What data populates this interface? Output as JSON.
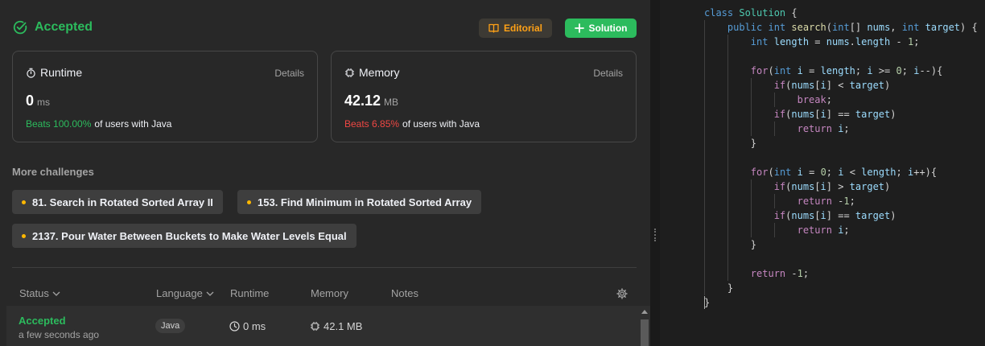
{
  "submission": {
    "status": "Accepted",
    "editorial_label": "Editorial",
    "solution_label": "Solution"
  },
  "runtime_card": {
    "title": "Runtime",
    "details": "Details",
    "value": "0",
    "unit": "ms",
    "beats": "Beats 100.00%",
    "suffix": "of users with Java"
  },
  "memory_card": {
    "title": "Memory",
    "details": "Details",
    "value": "42.12",
    "unit": "MB",
    "beats": "Beats 6.85%",
    "suffix": "of users with Java"
  },
  "more_challenges": {
    "title": "More challenges",
    "items": [
      "81. Search in Rotated Sorted Array II",
      "153. Find Minimum in Rotated Sorted Array",
      "2137. Pour Water Between Buckets to Make Water Levels Equal"
    ]
  },
  "history": {
    "columns": [
      "Status",
      "Language",
      "Runtime",
      "Memory",
      "Notes"
    ],
    "rows": [
      {
        "status": "Accepted",
        "time": "a few seconds ago",
        "language": "Java",
        "runtime": "0 ms",
        "memory": "42.1 MB"
      }
    ]
  },
  "editor": {
    "lines": [
      "class Solution {",
      "    public int search(int[] nums, int target) {",
      "        int length = nums.length - 1;",
      "",
      "        for(int i = length; i >= 0; i--){",
      "            if(nums[i] < target)",
      "                break;",
      "            if(nums[i] == target)",
      "                return i;",
      "        }",
      "",
      "        for(int i = 0; i < length; i++){",
      "            if(nums[i] > target)",
      "                return -1;",
      "            if(nums[i] == target)",
      "                return i;",
      "        }",
      "",
      "        return -1;",
      "    }",
      "}"
    ],
    "current_line": 21
  },
  "colors": {
    "accepted": "#2cbb5d",
    "editorial": "#ffa116",
    "beats_good": "#2cbb5d",
    "beats_bad": "#ef4743"
  },
  "icons": {
    "status": "check-circle-icon",
    "editorial": "book-icon",
    "solution": "plus-icon",
    "runtime": "stopwatch-icon",
    "memory": "chip-icon",
    "settings": "gear-icon"
  }
}
